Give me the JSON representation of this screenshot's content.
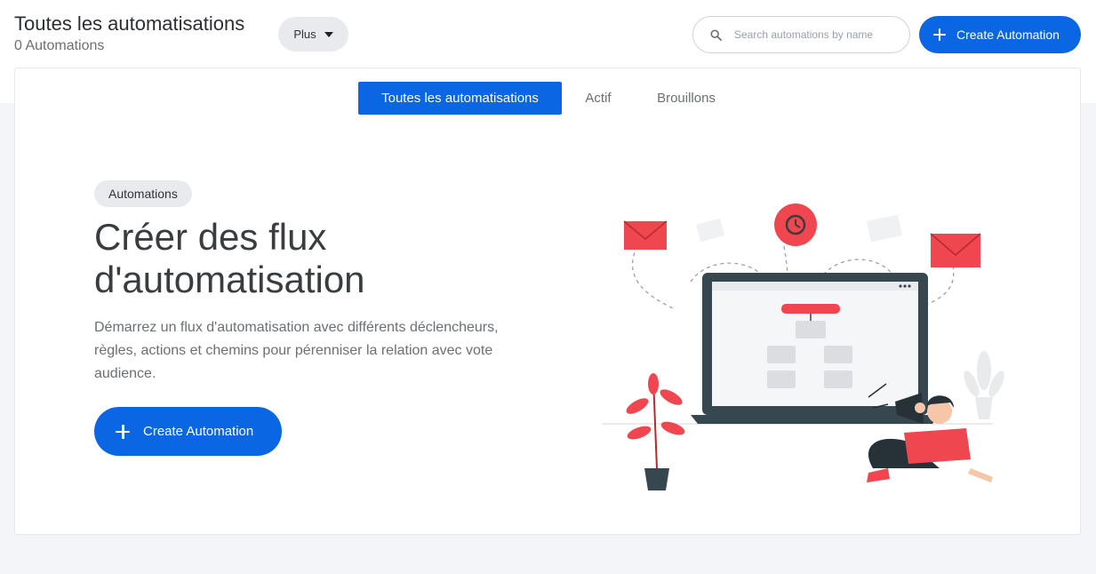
{
  "header": {
    "title": "Toutes les automatisations",
    "count_label": "0 Automations",
    "more_button": "Plus",
    "search_placeholder": "Search automations by name",
    "create_button": "Create Automation"
  },
  "tabs": [
    {
      "label": "Toutes les automatisations",
      "active": true
    },
    {
      "label": "Actif",
      "active": false
    },
    {
      "label": "Brouillons",
      "active": false
    }
  ],
  "empty_state": {
    "badge": "Automations",
    "title": "Créer des flux d'automatisation",
    "description": "Démarrez un flux d'automatisation avec différents déclencheurs, règles, actions et chemins pour pérenniser la relation avec vote audience.",
    "create_button": "Create Automation"
  },
  "icons": {
    "search": "search-icon",
    "caret": "caret-down-icon",
    "plus": "plus-icon"
  },
  "colors": {
    "primary": "#0b66e4",
    "accent_red": "#f0464f",
    "page_bg": "#f4f5f8",
    "chip_bg": "#e8eaee"
  }
}
